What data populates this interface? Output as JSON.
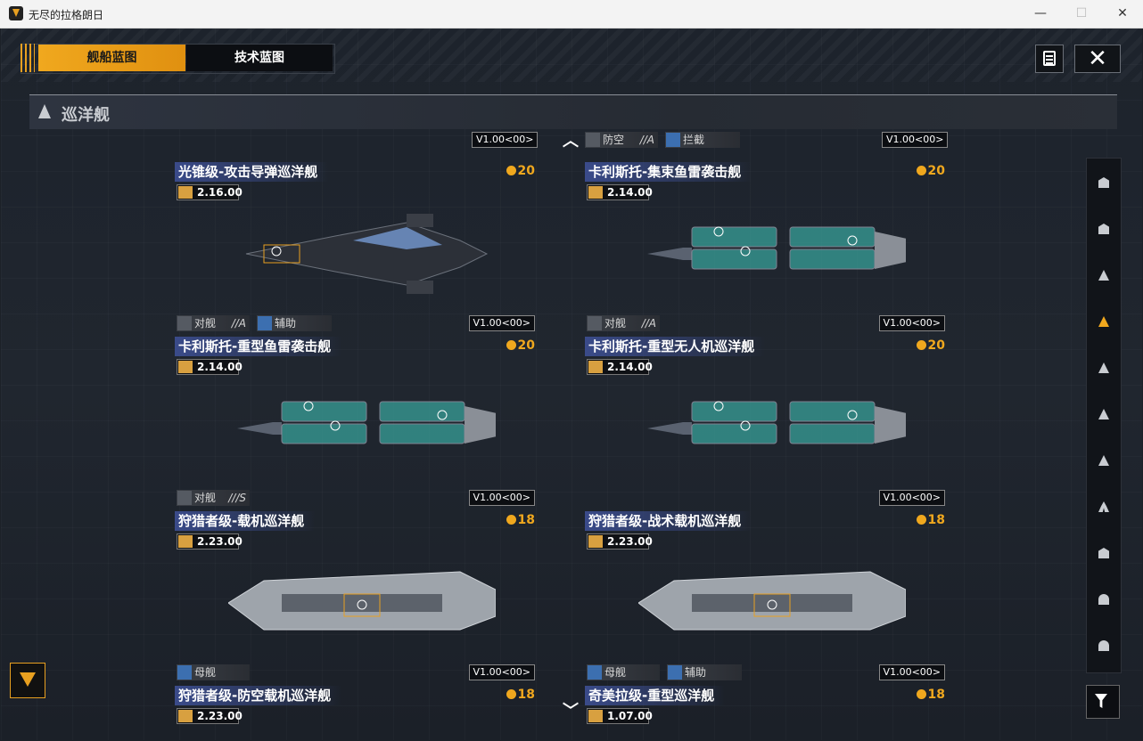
{
  "window": {
    "title": "无尽的拉格朗日"
  },
  "tabs": {
    "active": "舰船蓝图",
    "inactive": "技术蓝图"
  },
  "category": {
    "title": "巡洋舰"
  },
  "colors": {
    "accent": "#f0a81e",
    "name_bar": "#3a4b8a"
  },
  "top_tags": [
    {
      "label": "防空",
      "grade": "//A",
      "icon": "anti-air-icon"
    },
    {
      "label": "拦截",
      "grade": "",
      "icon": "intercept-icon"
    }
  ],
  "version_labels": [
    "V1.00<00>",
    "V1.00<00>"
  ],
  "cards": [
    {
      "name": "光锥级-攻击导弹巡洋舰",
      "cost": "20",
      "version": "2.16.00",
      "tags": [
        {
          "label": "对舰",
          "grade": "//A"
        },
        {
          "label": "辅助",
          "grade": ""
        }
      ],
      "badge": "V1.00<00>"
    },
    {
      "name": "卡利斯托-集束鱼雷袭击舰",
      "cost": "20",
      "version": "2.14.00",
      "tags": [
        {
          "label": "对舰",
          "grade": "//A"
        }
      ],
      "badge": "V1.00<00>"
    },
    {
      "name": "卡利斯托-重型鱼雷袭击舰",
      "cost": "20",
      "version": "2.14.00",
      "tags": [
        {
          "label": "对舰",
          "grade": "///S"
        }
      ],
      "badge": "V1.00<00>"
    },
    {
      "name": "卡利斯托-重型无人机巡洋舰",
      "cost": "20",
      "version": "2.14.00",
      "tags": [],
      "badge": "V1.00<00>"
    },
    {
      "name": "狩猎者级-载机巡洋舰",
      "cost": "18",
      "version": "2.23.00",
      "tags": [
        {
          "label": "母舰",
          "grade": ""
        }
      ],
      "badge": "V1.00<00>"
    },
    {
      "name": "狩猎者级-战术载机巡洋舰",
      "cost": "18",
      "version": "2.23.00",
      "tags": [
        {
          "label": "母舰",
          "grade": ""
        },
        {
          "label": "辅助",
          "grade": ""
        }
      ],
      "badge": "V1.00<00>"
    },
    {
      "name": "狩猎者级-防空载机巡洋舰",
      "cost": "18",
      "version": "2.23.00"
    },
    {
      "name": "奇美拉级-重型巡洋舰",
      "cost": "18",
      "version": "1.07.00"
    }
  ],
  "sidebar": [
    "carrier-icon",
    "battlecruiser-icon",
    "destroyer-icon",
    "cruiser-icon",
    "frigate-icon",
    "corvette-icon",
    "fighter-icon",
    "squad-icon",
    "station-icon",
    "auxiliary-icon",
    "dome-icon"
  ]
}
